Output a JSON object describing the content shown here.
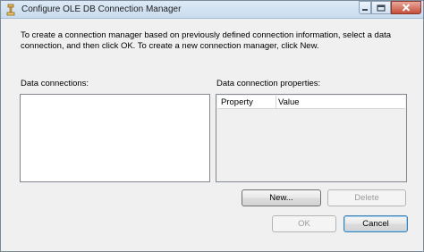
{
  "window": {
    "title": "Configure OLE DB Connection Manager",
    "icon": "connection-manager-icon"
  },
  "instruction": "To create a connection manager based on previously defined connection information, select a data connection, and then click OK. To create a new connection manager, click New.",
  "data_connections": {
    "label": "Data connections:",
    "items": []
  },
  "properties": {
    "label": "Data connection properties:",
    "columns": [
      "Property",
      "Value"
    ],
    "rows": []
  },
  "buttons": {
    "new": "New...",
    "delete": "Delete",
    "ok": "OK",
    "cancel": "Cancel"
  },
  "colors": {
    "titlebar": "#c9dcef",
    "close_button": "#c74d3a",
    "dialog_background": "#f0f0f0"
  }
}
